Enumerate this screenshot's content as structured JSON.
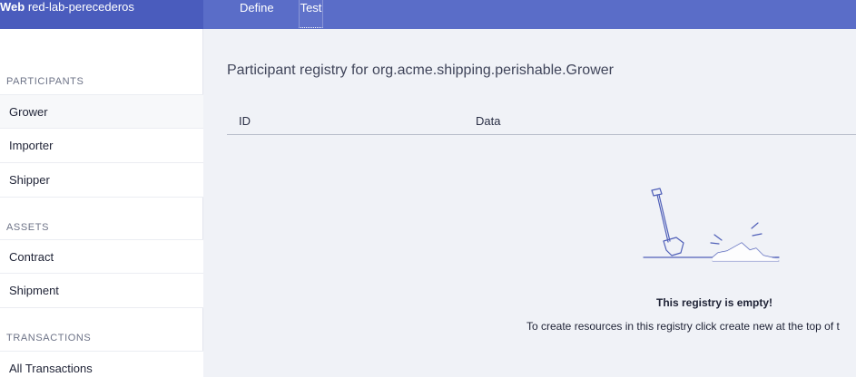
{
  "header": {
    "brand_bold": "Web",
    "brand_name": "red-lab-perecederos",
    "tabs": [
      {
        "label": "Define"
      },
      {
        "label": "Test"
      }
    ]
  },
  "sidebar": {
    "sections": [
      {
        "title": "PARTICIPANTS",
        "items": [
          {
            "label": "Grower"
          },
          {
            "label": "Importer"
          },
          {
            "label": "Shipper"
          }
        ]
      },
      {
        "title": "ASSETS",
        "items": [
          {
            "label": "Contract"
          },
          {
            "label": "Shipment"
          }
        ]
      },
      {
        "title": "TRANSACTIONS",
        "items": [
          {
            "label": "All Transactions"
          }
        ]
      }
    ]
  },
  "main": {
    "title": "Participant registry for org.acme.shipping.perishable.Grower",
    "columns": [
      "ID",
      "Data"
    ],
    "empty_title": "This registry is empty!",
    "empty_description": "To create resources in this registry click create new at the top of t"
  },
  "colors": {
    "header_bg": "#5a6dc8",
    "brand_bg": "#4a5cbd",
    "illustration": "#4f5fb8"
  }
}
